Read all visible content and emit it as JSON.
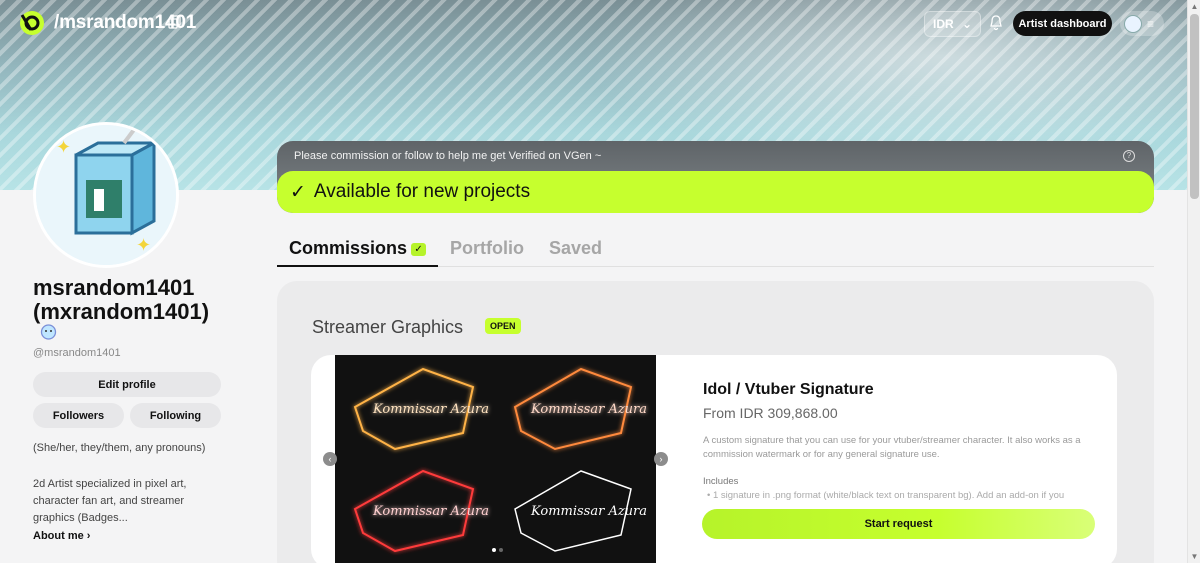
{
  "nav": {
    "handle": "/msrandom1401",
    "currency": "IDR",
    "artist_dashboard": "Artist dashboard"
  },
  "profile": {
    "display_name": "msrandom1401 (mxrandom1401)",
    "username": "@msrandom1401",
    "edit_profile": "Edit profile",
    "followers": "Followers",
    "following": "Following",
    "pronouns": "(She/her, they/them, any pronouns)",
    "bio": "2d Artist specialized in pixel art, character fan art, and streamer graphics (Badges...",
    "about_me": "About me"
  },
  "verify": {
    "message": "Please commission or follow to help me get Verified on VGen ~",
    "status": "Available for new projects"
  },
  "tabs": [
    {
      "label": "Commissions"
    },
    {
      "label": "Portfolio"
    },
    {
      "label": "Saved"
    }
  ],
  "section": {
    "title": "Streamer Graphics",
    "status_badge": "OPEN"
  },
  "offer": {
    "title": "Idol / Vtuber Signature",
    "price": "From IDR 309,868.00",
    "description": "A custom signature that you can use for your vtuber/streamer character. It also works as a commission watermark or for any general signature use.",
    "includes_title": "Includes",
    "includes_item": "• 1 signature in .png format (white/black text on transparent bg). Add an add-on if you",
    "start_request": "Start request",
    "gallery_images": [
      {
        "text": "Kommissar Azura",
        "glow": "#ffb347",
        "icon": "signature-orange-glow"
      },
      {
        "text": "Kommissar Azura",
        "glow": "#ff8a3d",
        "icon": "signature-orange"
      },
      {
        "text": "Kommissar Azura",
        "glow": "#ff3b3b",
        "icon": "signature-red"
      },
      {
        "text": "Kommissar Azura",
        "glow": "#ffffff",
        "icon": "signature-white"
      }
    ],
    "gallery_page": 1,
    "gallery_pages": 2
  },
  "colors": {
    "accent": "#c6ff2e",
    "dark": "#111111",
    "panel": "#ebebec"
  }
}
